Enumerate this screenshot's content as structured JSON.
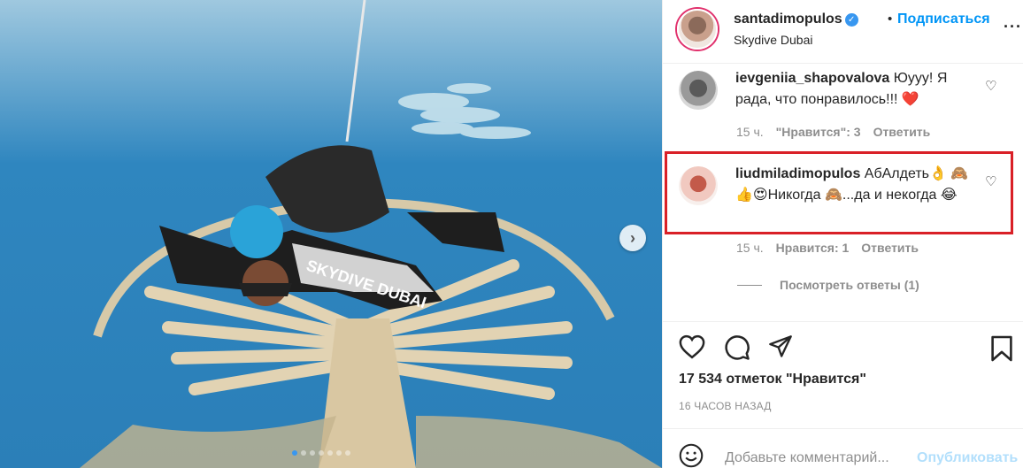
{
  "header": {
    "username": "santadimopulos",
    "verified_mark": "✓",
    "separator": "•",
    "follow_label": "Подписаться",
    "location": "Skydive Dubai",
    "more_label": "···"
  },
  "comments": [
    {
      "username": "ievgeniia_shapovalova",
      "text": "Юууу! Я рада, что понравилось!!! ❤️",
      "time": "15 ч.",
      "likes": "\"Нравится\": 3",
      "reply_label": "Ответить"
    },
    {
      "username": "liudmiladimopulos",
      "text": "АбАлдеть👌 🙈👍😍Никогда 🙈...да и некогда 😂",
      "time": "15 ч.",
      "likes": "Нравится: 1",
      "reply_label": "Ответить"
    }
  ],
  "view_replies": "Посмотреть ответы (1)",
  "likes_count": "17 534 отметок \"Нравится\"",
  "post_time": "16 ЧАСОВ НАЗАД",
  "add_comment": {
    "placeholder": "Добавьте комментарий...",
    "publish_label": "Опубликовать"
  },
  "photo": {
    "jumpsuit_text": "SKYDIVE DUBAI",
    "next_glyph": "›"
  },
  "colors": {
    "follow": "#0095f6",
    "highlight": "#d92027",
    "heart": "#ed4956",
    "carousel_active": "#3897f0"
  }
}
